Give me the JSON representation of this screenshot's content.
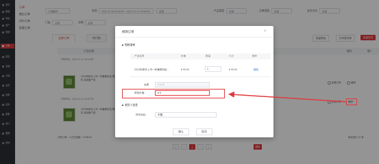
{
  "sidebar": {
    "items": [
      {
        "label": "首页"
      },
      {
        "label": "数据"
      },
      {
        "label": "商品"
      },
      {
        "label": "用户"
      },
      {
        "label": "营销"
      },
      {
        "label": "订单"
      },
      {
        "label": "财务"
      },
      {
        "label": "店铺"
      },
      {
        "label": "分销"
      },
      {
        "label": "会员"
      },
      {
        "label": "设置"
      },
      {
        "label": "应用"
      },
      {
        "label": "客服"
      },
      {
        "label": "统计"
      },
      {
        "label": "直播"
      },
      {
        "label": "其他"
      }
    ],
    "active_index": 5
  },
  "submenu": {
    "items": [
      {
        "label": "订单"
      },
      {
        "label": "售后订单"
      },
      {
        "label": "评价订单"
      },
      {
        "label": "批量工具"
      }
    ]
  },
  "filters": {
    "keyword_placeholder": "订单编号",
    "time_label": "时间",
    "time_value": "2022-11-28 00:00:00  ~  2022-12-14 23:59:59",
    "order_type_value": "全部",
    "product_type_label": "产品类型",
    "product_type_value": "全部",
    "order_status_label": "订单类型",
    "order_status_value": "全部",
    "pay_label": "支付方式",
    "pay_value": "全部",
    "store_label": "门店",
    "store_value": "全部",
    "dist_label": "分销",
    "dist_value": "全部"
  },
  "tabs": [
    {
      "label": "全部订单"
    },
    {
      "label": "待付款"
    }
  ],
  "toolbar": {
    "export_label": "批量导出",
    "print_label": "打印发货单",
    "ship_label": "批量发货"
  },
  "table": {
    "product_header": "产品名称",
    "actions_header": "操作",
    "extra_header": "推广"
  },
  "orders": [
    {
      "header": "下单时间：2022-12-14 18:12:50",
      "product": "2023年新年上市一杯兼顾科技 喝多了就醉的饮料 高纯度产品",
      "opt1": "查看订单",
      "opt2": "编辑"
    },
    {
      "header": "下单时间：2022-12-14 16:57:09",
      "product": "2023年新年上市一杯兼顾科技 喝多了就醉的饮料 高纯度产品",
      "opt1": "查看订单",
      "opt2": "编辑"
    }
  ],
  "footer": {
    "summary": "共有订单：2 已付金额：¥ 238.00",
    "per_page": "每页显示 10 条"
  },
  "pagination": {
    "pages": [
      "«",
      "‹",
      "1",
      "›",
      "»"
    ],
    "go_label": "跳转"
  },
  "modal": {
    "title": "修改订单",
    "close": "×",
    "section_products": "购物清单",
    "columns": {
      "name": "产品名称",
      "price": "价格",
      "qty": "数量",
      "subtotal": "小计",
      "action": "操作"
    },
    "item": {
      "name": "2023年新年上市一杯兼顾科技...",
      "price": "¥ 99.00",
      "qty": "1",
      "subtotal": "¥ 99.00",
      "action": "删除"
    },
    "freight_label": "运费",
    "freight_value": "¥  0.00",
    "discount_label": "修改价格：",
    "discount_value": "¥  0",
    "section_address": "收货人信息",
    "region_label": "所在地区：",
    "region_value": "中国",
    "confirm_label": "确认",
    "cancel_label": "取消"
  },
  "colors": {
    "accent": "#e0393e",
    "rail": "#2b2f36"
  }
}
